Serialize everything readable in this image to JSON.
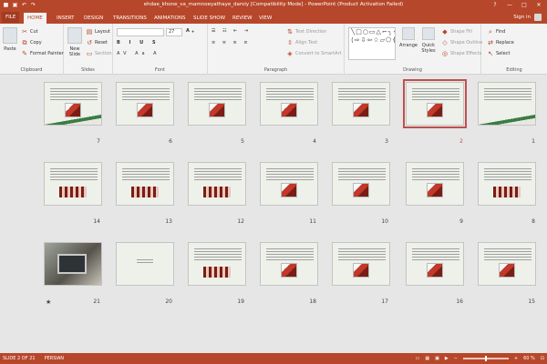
{
  "window": {
    "title": "ehdae_khone_va_mamnoeyathaye_daroiy [Compatibility Mode] - PowerPoint (Product Activation Failed)"
  },
  "account": {
    "signin_label": "Sign in"
  },
  "tabs": [
    "FILE",
    "HOME",
    "INSERT",
    "DESIGN",
    "TRANSITIONS",
    "ANIMATIONS",
    "SLIDE SHOW",
    "REVIEW",
    "VIEW"
  ],
  "ribbon": {
    "clipboard": {
      "paste": "Paste",
      "cut": "Cut",
      "copy": "Copy",
      "format_painter": "Format Painter",
      "label": "Clipboard"
    },
    "slides": {
      "new_slide": "New Slide",
      "layout": "Layout",
      "reset": "Reset",
      "section": "Section",
      "label": "Slides"
    },
    "font": {
      "size": "27",
      "label": "Font"
    },
    "paragraph": {
      "text_direction": "Text Direction",
      "align_text": "Align Text",
      "convert_smartart": "Convert to SmartArt",
      "label": "Paragraph"
    },
    "drawing": {
      "arrange": "Arrange",
      "quick_styles": "Quick Styles",
      "shape_fill": "Shape Fill",
      "shape_outline": "Shape Outline",
      "shape_effects": "Shape Effects",
      "label": "Drawing"
    },
    "editing": {
      "find": "Find",
      "replace": "Replace",
      "select": "Select",
      "label": "Editing"
    }
  },
  "slides": [
    {
      "number": "7"
    },
    {
      "number": "6"
    },
    {
      "number": "5"
    },
    {
      "number": "4"
    },
    {
      "number": "3"
    },
    {
      "number": "2",
      "selected": true
    },
    {
      "number": "1"
    },
    {
      "number": "14"
    },
    {
      "number": "13"
    },
    {
      "number": "12"
    },
    {
      "number": "11"
    },
    {
      "number": "10"
    },
    {
      "number": "9"
    },
    {
      "number": "8"
    },
    {
      "number": "21"
    },
    {
      "number": "20"
    },
    {
      "number": "19"
    },
    {
      "number": "18"
    },
    {
      "number": "17"
    },
    {
      "number": "16"
    },
    {
      "number": "15"
    }
  ],
  "status": {
    "slide_info": "SLIDE 2 OF 21",
    "language": "PERSIAN",
    "zoom": "60 %"
  },
  "colors": {
    "accent": "#b7472a",
    "selection": "#c0504d"
  }
}
